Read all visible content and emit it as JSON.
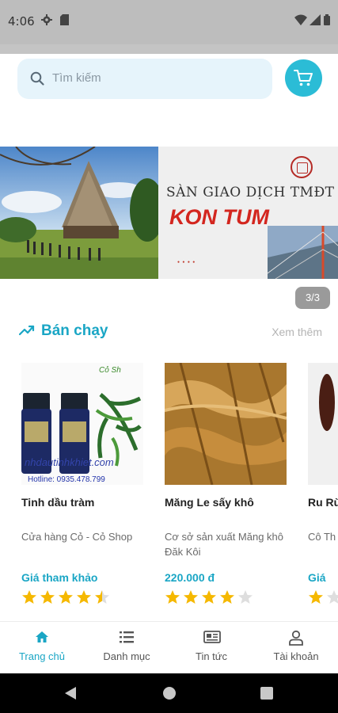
{
  "status_bar": {
    "time": "4:06"
  },
  "search": {
    "placeholder": "Tìm kiếm"
  },
  "banner": {
    "title_line1": "SÀN GIAO DỊCH TMĐT",
    "title_line2": "KON TUM",
    "pager": "3/3"
  },
  "section": {
    "title": "Bán chạy",
    "see_more": "Xem thêm"
  },
  "products": [
    {
      "name": "Tinh dầu tràm",
      "shop": "Cửa hàng Cỏ - Cỏ Shop",
      "price": "Giá tham khảo",
      "rating": 4.5
    },
    {
      "name": "Măng Le sấy khô",
      "shop": "Cơ sở sản xuất Măng khô Đăk Kôi",
      "price": "220.000 đ",
      "rating": 4
    },
    {
      "name": "Ru Rù",
      "shop": "Cô Th",
      "price": "Giá",
      "rating": 1
    }
  ],
  "bottom_nav": [
    {
      "label": "Trang chủ",
      "icon": "home-icon",
      "active": true
    },
    {
      "label": "Danh mục",
      "icon": "list-icon",
      "active": false
    },
    {
      "label": "Tin tức",
      "icon": "news-icon",
      "active": false
    },
    {
      "label": "Tài khoản",
      "icon": "user-icon",
      "active": false
    }
  ],
  "colors": {
    "accent": "#1aa6c5",
    "cart": "#2bbcd6",
    "star": "#f5b800",
    "star_empty": "#dedede"
  }
}
